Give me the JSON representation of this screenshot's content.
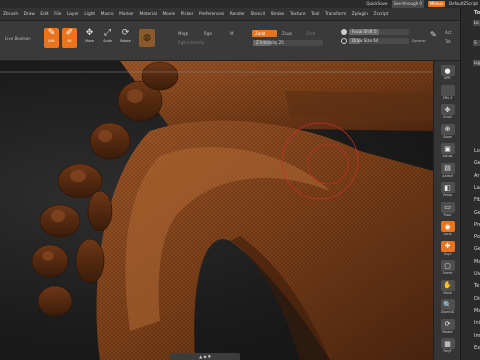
{
  "titlebar": {
    "quicksave": "QuickSave",
    "seethrough": "See-through  0",
    "menus": "Menus",
    "script": "DefaultZScript"
  },
  "menubar": [
    "Zbrush",
    "Draw",
    "Edit",
    "File",
    "Layer",
    "Light",
    "Macro",
    "Marker",
    "Material",
    "Movie",
    "Picker",
    "Preferences",
    "Render",
    "Stencil",
    "Stroke",
    "Texture",
    "Tool",
    "Transform",
    "Zplugin",
    "Zscript"
  ],
  "shelf": {
    "lightbox": "Live Boolean",
    "edit": "Edit",
    "draw": "64",
    "move": "Move",
    "scale": "Scale",
    "rotate": "Rotate",
    "mrgb": "Mrgb",
    "rgb": "Rgb",
    "m": "M",
    "rgb_intensity": "Rgb Intensity",
    "zadd": "Zadd",
    "zsub": "Zsub",
    "zcut": "Zcut",
    "z_intensity_label": "Z Intensity",
    "z_intensity": "25",
    "focal_label": "Focal Shift",
    "focal": "0",
    "draw_label": "Draw Size",
    "dynamic": "Dynamic",
    "a1": "Act",
    "a2": "Tot"
  },
  "righttools": [
    {
      "name": "bpr",
      "label": "BPR",
      "glyph": "●"
    },
    {
      "name": "spix",
      "label": "SPix 3",
      "glyph": ""
    },
    {
      "name": "scroll",
      "label": "Scroll",
      "glyph": "✥"
    },
    {
      "name": "zoom",
      "label": "Zoom",
      "glyph": "⊕"
    },
    {
      "name": "actual",
      "label": "Actual",
      "glyph": "▣"
    },
    {
      "name": "aahalf",
      "label": "AAHalf",
      "glyph": "▤"
    },
    {
      "name": "persp",
      "label": "Persp",
      "glyph": "◧"
    },
    {
      "name": "floor",
      "label": "Floor",
      "glyph": "▭"
    },
    {
      "name": "local",
      "label": "Local",
      "glyph": "◉"
    },
    {
      "name": "gxyz",
      "label": "Gxyz",
      "glyph": "✚"
    },
    {
      "name": "frame",
      "label": "Frame",
      "glyph": "▢"
    },
    {
      "name": "move",
      "label": "Move",
      "glyph": "✋"
    },
    {
      "name": "zoom3d",
      "label": "Zoom3D",
      "glyph": "🔍"
    },
    {
      "name": "rotate",
      "label": "Rotate",
      "glyph": "⟳"
    },
    {
      "name": "polyf",
      "label": "PolyF",
      "glyph": "▦"
    }
  ],
  "tray": {
    "title": "To",
    "items": [
      "Lo",
      "S",
      "Lig",
      "Lo",
      "Ge",
      "Ar",
      "Lay",
      "Fib",
      "Ge",
      "Pre",
      "Pol",
      "Ge",
      "Ma",
      "Uv",
      "Te",
      "Dis",
      "Ma",
      "Init",
      "Imp",
      "Exp"
    ]
  },
  "colors": {
    "accent": "#e8741e",
    "wood": "#8b4a22",
    "brush": "#d02a2a"
  }
}
